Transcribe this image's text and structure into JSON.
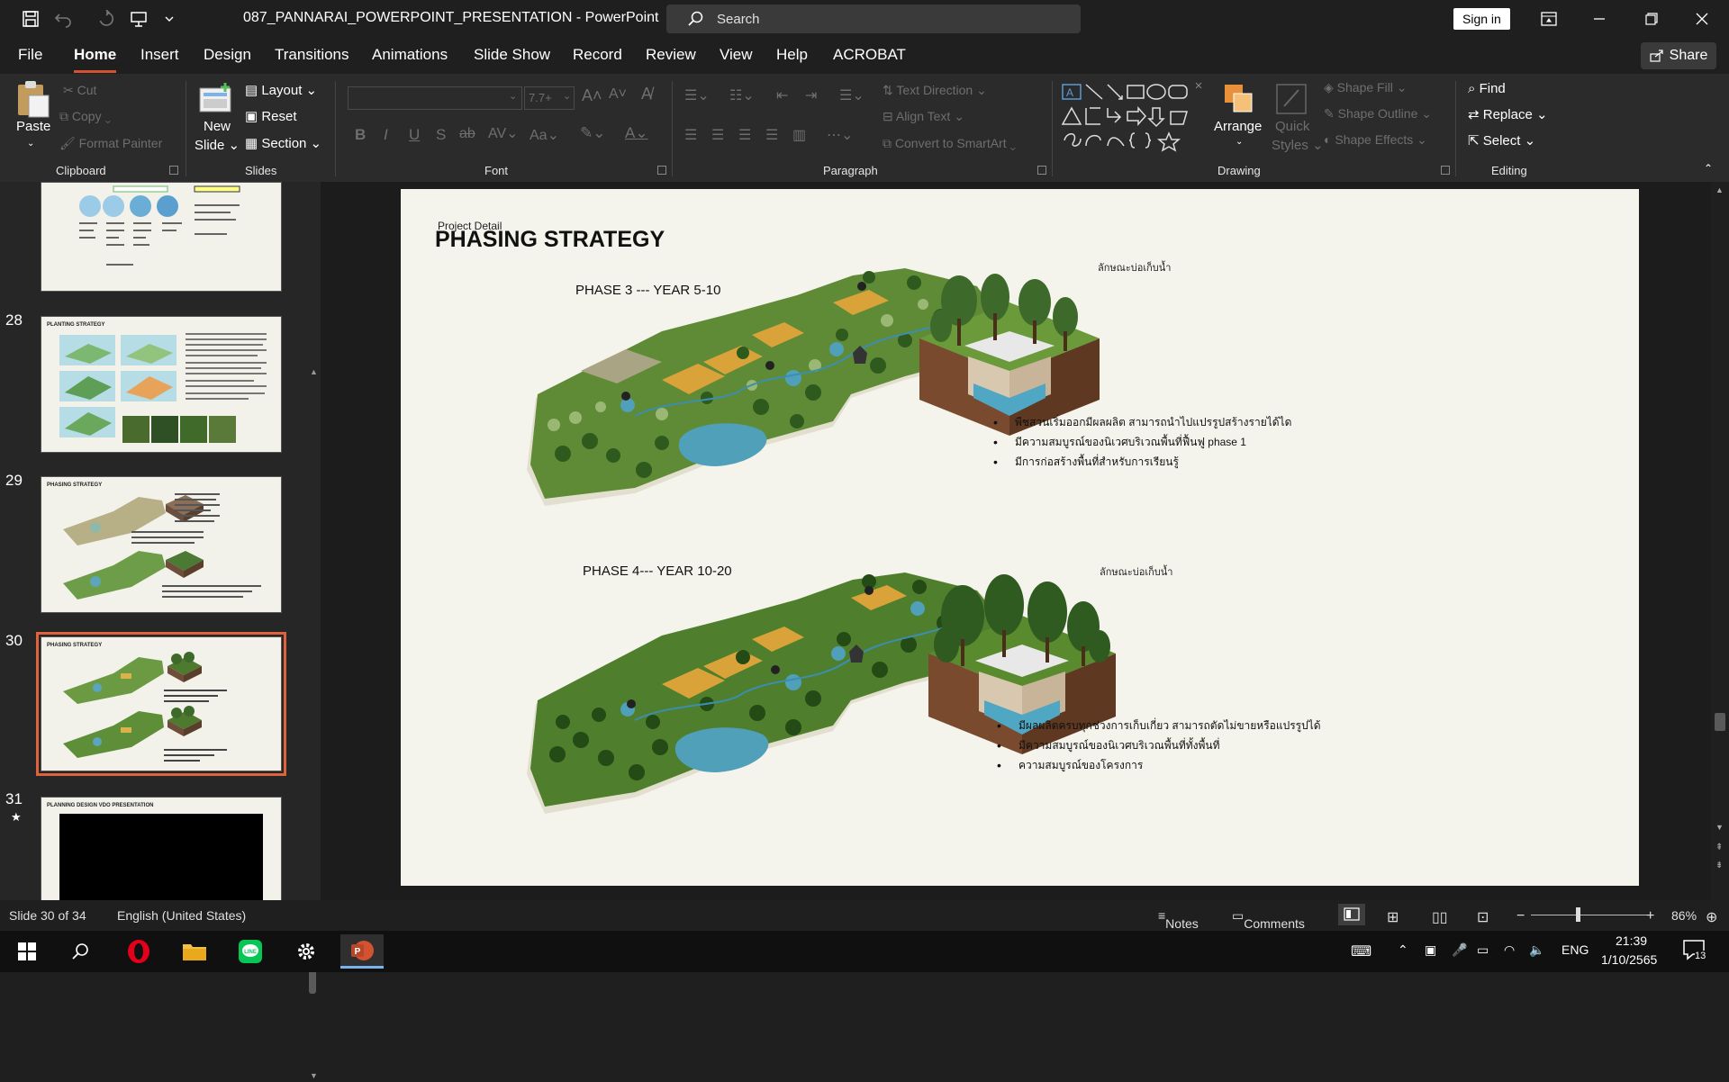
{
  "app": {
    "doc_title": "087_PANNARAI_POWERPOINT_PRESENTATION",
    "app_name": "PowerPoint",
    "separator": "-",
    "search_label": "Search",
    "sign_in": "Sign in",
    "share": "Share"
  },
  "menu": [
    "File",
    "Home",
    "Insert",
    "Design",
    "Transitions",
    "Animations",
    "Slide Show",
    "Record",
    "Review",
    "View",
    "Help",
    "ACROBAT"
  ],
  "active_tab": "Home",
  "ribbon": {
    "clipboard": {
      "group": "Clipboard",
      "paste": "Paste",
      "cut": "Cut",
      "copy": "Copy",
      "format_painter": "Format Painter"
    },
    "slides": {
      "group": "Slides",
      "new_slide_1": "New",
      "new_slide_2": "Slide",
      "layout": "Layout",
      "reset": "Reset",
      "section": "Section"
    },
    "font": {
      "group": "Font",
      "font_name": "",
      "font_size": "7.7+"
    },
    "paragraph": {
      "group": "Paragraph",
      "text_direction": "Text Direction",
      "align_text": "Align Text",
      "convert_smartart": "Convert to SmartArt"
    },
    "drawing": {
      "group": "Drawing",
      "arrange": "Arrange",
      "quick_styles_1": "Quick",
      "quick_styles_2": "Styles",
      "shape_fill": "Shape Fill",
      "shape_outline": "Shape Outline",
      "shape_effects": "Shape Effects"
    },
    "editing": {
      "group": "Editing",
      "find": "Find",
      "replace": "Replace",
      "select": "Select"
    }
  },
  "thumbnails": [
    {
      "num": "",
      "title": ""
    },
    {
      "num": "28",
      "title": "PLANTING STRATEGY"
    },
    {
      "num": "29",
      "title": "PHASING STRATEGY"
    },
    {
      "num": "30",
      "title": "PHASING STRATEGY"
    },
    {
      "num": "31",
      "title": "PLANNING DESIGN VDO PRESENTATION"
    }
  ],
  "slide": {
    "small_label": "Project Detail",
    "title": "PHASING STRATEGY",
    "phase3": {
      "label": "PHASE 3 --- YEAR 5-10",
      "caption": "ลักษณะบ่อเก็บน้ำ",
      "bullets": [
        "พืชสวนเริ่มออกมีผลผลิต สามารถนำไปแปรรูปสร้างรายได้ได",
        "มีความสมบูรณ์ของนิเวศบริเวณพื้นที่ฟื้นฟู phase 1",
        "มีการก่อสร้างพื้นที่สำหรับการเรียนรู้"
      ]
    },
    "phase4": {
      "label": "PHASE 4--- YEAR 10-20",
      "caption": "ลักษณะบ่อเก็บน้ำ",
      "bullets": [
        "มีผลผลิตครบทุกช่วงการเก็บเกี่ยว สามารถตัดไม่ขายหรือแปรรูปได้",
        "มีความสมบูรณ์ของนิเวศบริเวณพื้นที่ทั้งพื้นที่",
        "ความสมบูรณ์ของโครงการ"
      ]
    }
  },
  "status": {
    "slide_info": "Slide 30 of 34",
    "language": "English (United States)",
    "notes": "Notes",
    "comments": "Comments",
    "zoom": "86%"
  },
  "taskbar": {
    "time": "21:39",
    "date": "1/10/2565",
    "lang": "ENG",
    "notif": "13"
  },
  "colors": {
    "accent": "#d35230",
    "selection": "#e0623c"
  }
}
